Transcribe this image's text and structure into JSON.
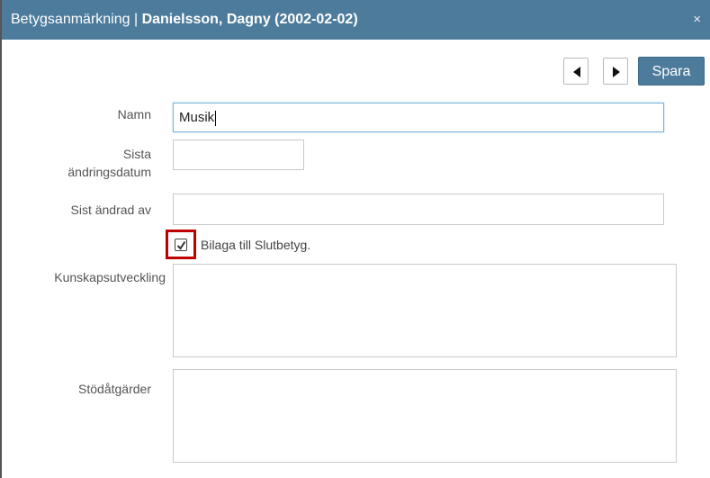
{
  "dialog": {
    "title_prefix": "Betygsanmärkning | ",
    "title_name": "Danielsson, Dagny (2002-02-02)",
    "close_symbol": "×"
  },
  "toolbar": {
    "prev_icon": "triangle-left-icon",
    "next_icon": "triangle-right-icon",
    "save_label": "Spara"
  },
  "form": {
    "name_label": "Namn",
    "name_value": "Musik",
    "date_label_line1": "Sista",
    "date_label_line2": "ändringsdatum",
    "date_value": "",
    "changed_by_label": "Sist ändrad av",
    "changed_by_value": "",
    "attachment_checked": true,
    "attachment_label": "Bilaga till Slutbetyg.",
    "knowledge_label": "Kunskapsutveckling",
    "knowledge_value": "",
    "support_label": "Stödåtgärder",
    "support_value": ""
  },
  "colors": {
    "header": "#4d7b9b",
    "highlight": "#c00000",
    "focus_border": "#7fb4d6"
  }
}
